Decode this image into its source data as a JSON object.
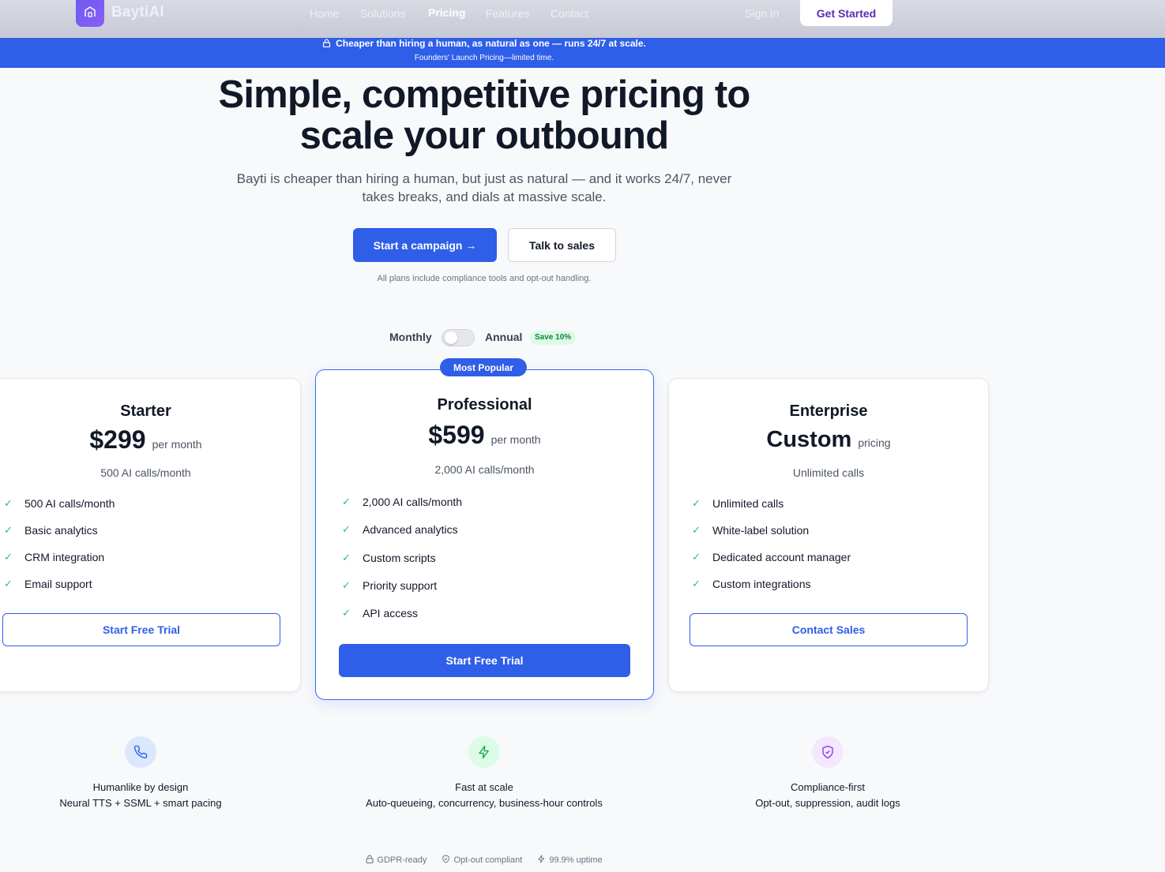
{
  "webview_tag": "webview",
  "brand": {
    "name": "BaytiAI",
    "icon": "building-icon"
  },
  "nav": {
    "links": [
      "Home",
      "Solutions",
      "Pricing",
      "Features",
      "Contact"
    ],
    "active": "Pricing",
    "signin": "Sign In",
    "cta": "Get Started"
  },
  "banner": {
    "icon": "lock-icon",
    "line1": "Cheaper than hiring a human, as natural as one — runs 24/7 at scale.",
    "line2": "Founders' Launch Pricing—limited time."
  },
  "hero": {
    "title_line1": "Simple, competitive pricing to",
    "title_line2": "scale your outbound",
    "subtitle": "Bayti is cheaper than hiring a human, but just as natural — and it works 24/7, never takes breaks, and dials at massive scale.",
    "primary_cta": "Start a campaign →",
    "secondary_cta": "Talk to sales",
    "note": "All plans include compliance tools and opt-out handling."
  },
  "billing": {
    "monthly_label": "Monthly",
    "annual_label": "Annual",
    "save_badge": "Save 10%",
    "annual_selected": false
  },
  "plans": [
    {
      "name": "Starter",
      "price": "$299",
      "unit": "per month",
      "calls": "500 AI calls/month",
      "features": [
        "500 AI calls/month",
        "Basic analytics",
        "CRM integration",
        "Email support"
      ],
      "cta": "Start Free Trial"
    },
    {
      "name": "Professional",
      "badge": "Most Popular",
      "price": "$599",
      "unit": "per month",
      "calls": "2,000 AI calls/month",
      "features": [
        "2,000 AI calls/month",
        "Advanced analytics",
        "Custom scripts",
        "Priority support",
        "API access"
      ],
      "cta": "Start Free Trial"
    },
    {
      "name": "Enterprise",
      "price": "Custom",
      "unit": "pricing",
      "calls": "Unlimited calls",
      "features": [
        "Unlimited calls",
        "White-label solution",
        "Dedicated account manager",
        "Custom integrations"
      ],
      "cta": "Contact Sales"
    }
  ],
  "benefits": [
    {
      "icon": "phone-icon",
      "title": "Humanlike by design",
      "desc": "Neural TTS + SSML + smart pacing",
      "color": "#2f5ee8",
      "bg": "#dbe7fd"
    },
    {
      "icon": "lightning-icon",
      "title": "Fast at scale",
      "desc": "Auto-queueing, concurrency, business-hour controls",
      "color": "#16a34a",
      "bg": "#dcfce7"
    },
    {
      "icon": "shield-check-icon",
      "title": "Compliance-first",
      "desc": "Opt-out, suppression, audit logs",
      "color": "#9333ea",
      "bg": "#f3e8ff"
    }
  ],
  "trust_badges": [
    {
      "icon": "lock-icon",
      "label": "GDPR-ready"
    },
    {
      "icon": "shield-icon",
      "label": "Opt-out compliant"
    },
    {
      "icon": "lightning-icon",
      "label": "99.9% uptime"
    }
  ]
}
